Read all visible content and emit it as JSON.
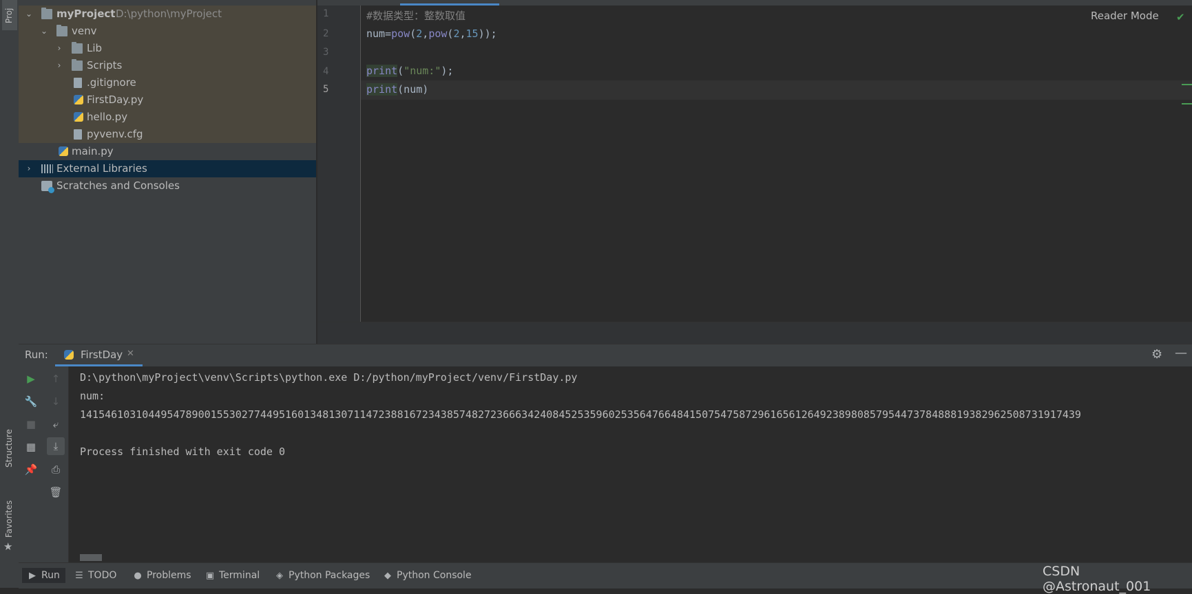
{
  "left_strip": {
    "project_tab": "Proj",
    "structure_tab": "Structure",
    "favorites_tab": "Favorites"
  },
  "project_tree": {
    "root": {
      "name": "myProject",
      "path": "D:\\python\\myProject"
    },
    "items": [
      {
        "label": "venv"
      },
      {
        "label": "Lib"
      },
      {
        "label": "Scripts"
      },
      {
        "label": ".gitignore"
      },
      {
        "label": "FirstDay.py"
      },
      {
        "label": "hello.py"
      },
      {
        "label": "pyvenv.cfg"
      },
      {
        "label": "main.py"
      },
      {
        "label": "External Libraries"
      },
      {
        "label": "Scratches and Consoles"
      }
    ]
  },
  "editor": {
    "reader_mode": "Reader Mode",
    "line_numbers": [
      "1",
      "2",
      "3",
      "4",
      "5"
    ],
    "lines": {
      "l1_comment": "#数据类型：整数取值",
      "l2": {
        "a": "num=",
        "b": "pow",
        "c": "(",
        "d": "2",
        "e": ",",
        "f": "pow",
        "g": "(",
        "h": "2",
        "i": ",",
        "j": "15",
        "k": "));"
      },
      "l4": {
        "a": "print",
        "b": "(",
        "c": "\"num:\"",
        "d": ");"
      },
      "l5": {
        "a": "print",
        "b": "(num)"
      }
    }
  },
  "run_panel": {
    "label": "Run:",
    "tab": "FirstDay",
    "close": "✕",
    "console": [
      "D:\\python\\myProject\\venv\\Scripts\\python.exe D:/python/myProject/venv/FirstDay.py",
      "num:",
      "14154610310449547890015530277449516013481307114723881672343857482723666342408452535960253564766484150754758729616561264923898085795447378488819382962508731917439",
      "",
      "Process finished with exit code 0"
    ]
  },
  "bottom_tabs": [
    {
      "label": "Run",
      "icon": "play-icon"
    },
    {
      "label": "TODO",
      "icon": "list-icon"
    },
    {
      "label": "Problems",
      "icon": "info-icon"
    },
    {
      "label": "Terminal",
      "icon": "terminal-icon"
    },
    {
      "label": "Python Packages",
      "icon": "layers-icon"
    },
    {
      "label": "Python Console",
      "icon": "python-icon"
    }
  ],
  "watermark": "CSDN @Astronaut_001"
}
